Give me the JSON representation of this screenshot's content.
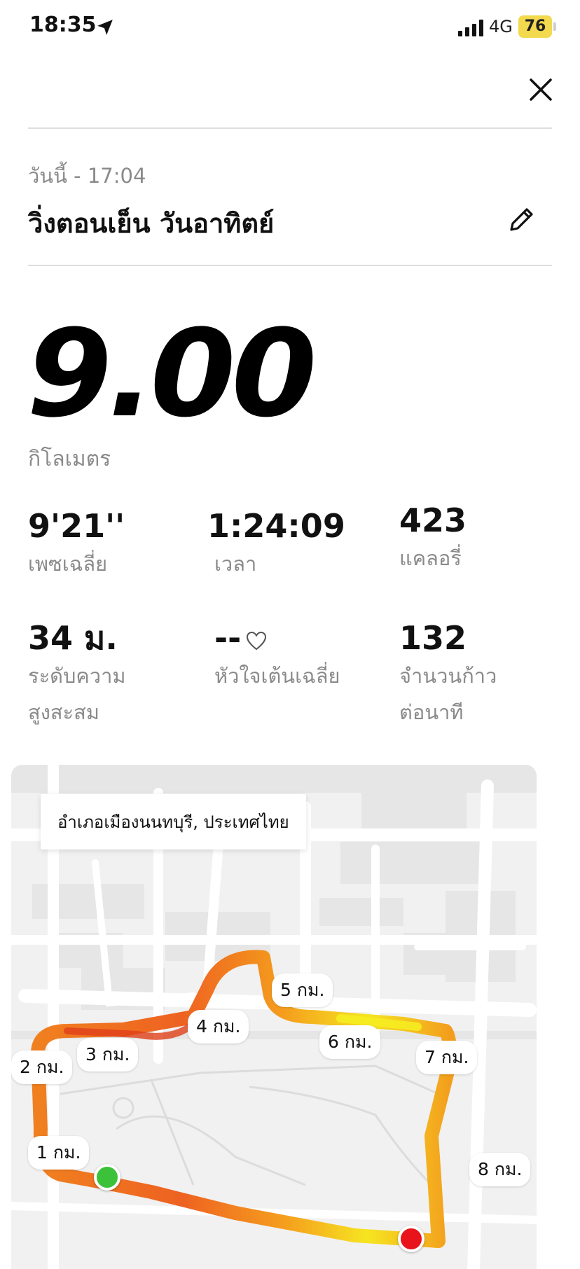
{
  "status_bar": {
    "time": "18:35",
    "network": "4G",
    "battery": "76"
  },
  "header": {
    "close_icon": "close-icon"
  },
  "activity": {
    "date": "วันนี้ - 17:04",
    "title": "วิ่งตอนเย็น วันอาทิตย์",
    "edit_icon": "pencil-icon",
    "distance": "9.00",
    "distance_unit": "กิโลเมตร"
  },
  "stats": {
    "pace": {
      "value": "9'21''",
      "label": "เพซเฉลี่ย"
    },
    "time": {
      "value": "1:24:09",
      "label": "เวลา"
    },
    "calories": {
      "value": "423",
      "label": "แคลอรี่"
    },
    "elevation": {
      "value": "34 ม.",
      "label": "ระดับความสูงสะสม"
    },
    "heart_rate": {
      "value": "--",
      "label": "หัวใจเต้นเฉลี่ย"
    },
    "cadence": {
      "value": "132",
      "label": "จำนวนก้าวต่อนาที"
    }
  },
  "map": {
    "location": "อำเภอเมืองนนทบุรี, ประเทศไทย",
    "km_markers": [
      "1 กม.",
      "2 กม.",
      "3 กม.",
      "4 กม.",
      "5 กม.",
      "6 กม.",
      "7 กม.",
      "8 กม."
    ],
    "start_color": "#3cc13b",
    "end_color": "#e8131b"
  }
}
